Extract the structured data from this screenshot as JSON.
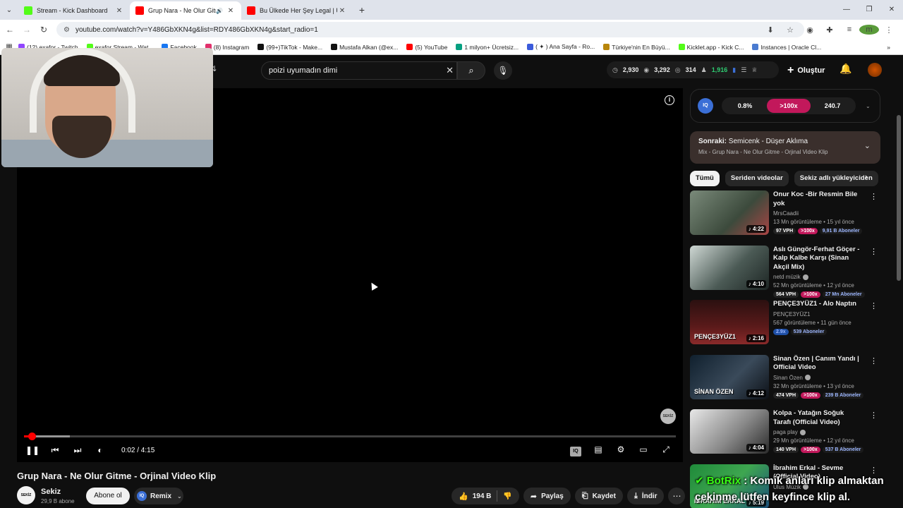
{
  "browser": {
    "tabs": [
      {
        "title": "Stream - Kick Dashboard",
        "fav_color": "#53fc18",
        "active": false
      },
      {
        "title": "Grup Nara - Ne Olur Gitme",
        "fav_color": "#ff0000",
        "active": true
      },
      {
        "title": "Bu Ülkede Her Şey Legal | Urug",
        "fav_color": "#ff0000",
        "active": false
      }
    ],
    "url": "youtube.com/watch?v=Y486GbXKN4g&list=RDY486GbXKN4g&start_radio=1",
    "bookmarks": [
      {
        "label": "(12) exafor - Twitch",
        "color": "#9146ff"
      },
      {
        "label": "exafor Stream - Wat...",
        "color": "#53fc18"
      },
      {
        "label": "Facebook",
        "color": "#1877f2"
      },
      {
        "label": "(8) Instagram",
        "color": "#e1306c"
      },
      {
        "label": "(99+)TikTok - Make...",
        "color": "#111111"
      },
      {
        "label": "Mustafa Alkan (@ex...",
        "color": "#111111"
      },
      {
        "label": "(5) YouTube",
        "color": "#ff0000"
      },
      {
        "label": "1 milyon+ Ücretsiz...",
        "color": "#05a081"
      },
      {
        "label": "( ✦ ) Ana Sayfa - Ro...",
        "color": "#3b5bdb"
      },
      {
        "label": "Türkiye'nin En Büyü...",
        "color": "#b8860b"
      },
      {
        "label": "Kicklet.app - Kick C...",
        "color": "#53fc18"
      },
      {
        "label": "Instances | Oracle Cl...",
        "color": "#4a7bd0"
      }
    ]
  },
  "youtube": {
    "search": {
      "value": "poizi uyumadın dimi",
      "placeholder": "Ara"
    },
    "stats": {
      "a": "2,930",
      "b": "3,292",
      "c": "314",
      "d": "1,916"
    },
    "create_label": "Oluştur",
    "player": {
      "current_time": "0:02 / 4:15",
      "progress": 0.008,
      "buffered": 0.07,
      "watermark": "SEKİZ"
    },
    "video": {
      "title": "Grup Nara - Ne Olur Gitme - Orjinal Video Klip",
      "channel": "Sekiz",
      "subs": "29,9 B abone",
      "channel_avatar_text": "SEKİZ",
      "subscribe_label": "Abone ol",
      "remix_label": "Remix",
      "likes": "194 B",
      "share_label": "Paylaş",
      "save_label": "Kaydet",
      "download_label": "İndir"
    },
    "iq_panel": {
      "logo": "IQ",
      "v1": "0.8%",
      "v2": ">100x",
      "v3": "240.7"
    },
    "up_next": {
      "label": "Sonraki:",
      "title": "Semicenk - Düşer Aklıma",
      "sub": "Mix - Grup Nara - Ne Olur Gitme - Orjinal Video Klip"
    },
    "chips": [
      "Tümü",
      "Seriden videolar",
      "Sekiz adlı yükleyiciden"
    ],
    "recommendations": [
      {
        "title": "Onur Koc -Bir Resmin Bile yok",
        "channel": "MrsCaadii",
        "meta": "13 Mn görüntüleme • 15 yıl önce",
        "dur": "4:22",
        "b1": "97 VPH",
        "b2": ">100x",
        "b3": "9,91 B Aboneler",
        "thumb": "linear-gradient(135deg,#7a8a7a,#3c4a3c 60%,#a44)",
        "thumb_text": "",
        "verified": false
      },
      {
        "title": "Aslı Güngör-Ferhat Göçer - Kalp Kalbe Karşı (Sinan Akçil Mix)",
        "channel": "netd müzik",
        "meta": "52 Mn görüntüleme • 12 yıl önce",
        "dur": "4:10",
        "b1": "564 VPH",
        "b2": ">100x",
        "b3": "27 Mn Aboneler",
        "thumb": "linear-gradient(135deg,#cfd8d4,#4b5a55 55%,#1d2624)",
        "thumb_text": "",
        "verified": true
      },
      {
        "title": "PENÇE3YÜZ1 - Alo Naptın",
        "channel": "PENÇE3YÜZ1",
        "meta": "567 görüntüleme • 11 gün önce",
        "dur": "2:16",
        "b1": "2.9x",
        "b2": "539 Aboneler",
        "b3": "",
        "thumb": "linear-gradient(180deg,#2b1010,#5a1a1a 60%,#8a2a2a)",
        "thumb_text": "PENÇE3YÜZ1",
        "verified": false
      },
      {
        "title": "Sinan Özen | Canım Yandı | Official Video",
        "channel": "Sinan Özen",
        "meta": "32 Mn görüntüleme • 13 yıl önce",
        "dur": "4:12",
        "b1": "474 VPH",
        "b2": ">100x",
        "b3": "239 B Aboneler",
        "thumb": "linear-gradient(135deg,#10202e,#3a4a5a 55%,#0c1016)",
        "thumb_text": "SİNAN ÖZEN",
        "verified": true
      },
      {
        "title": "Kolpa - Yatağın Soğuk Tarafı (Official Video)",
        "channel": "paga play",
        "meta": "29 Mn görüntüleme • 12 yıl önce",
        "dur": "4:04",
        "b1": "140 VPH",
        "b2": ">100x",
        "b3": "537 B Aboneler",
        "thumb": "linear-gradient(135deg,#e8e8e8,#8a8a8a 55%,#2a2a2a)",
        "thumb_text": "",
        "verified": true
      },
      {
        "title": "İbrahim Erkal - Sevme (Official Video)",
        "channel": "Ulus Müzik",
        "meta": "",
        "dur": "5:19",
        "b1": "",
        "b2": "",
        "b3": "",
        "thumb": "linear-gradient(135deg,#1f8a3a,#3ea650 50%,#1a4d7a)",
        "thumb_text": "İBRAHİM ERKAL",
        "verified": true
      }
    ]
  },
  "overlay": {
    "botrix_name": "BotRix",
    "botrix_msg": " : Komik anları klip almaktan",
    "botrix_msg2": "çekinme lütfen keyfince klip al."
  }
}
